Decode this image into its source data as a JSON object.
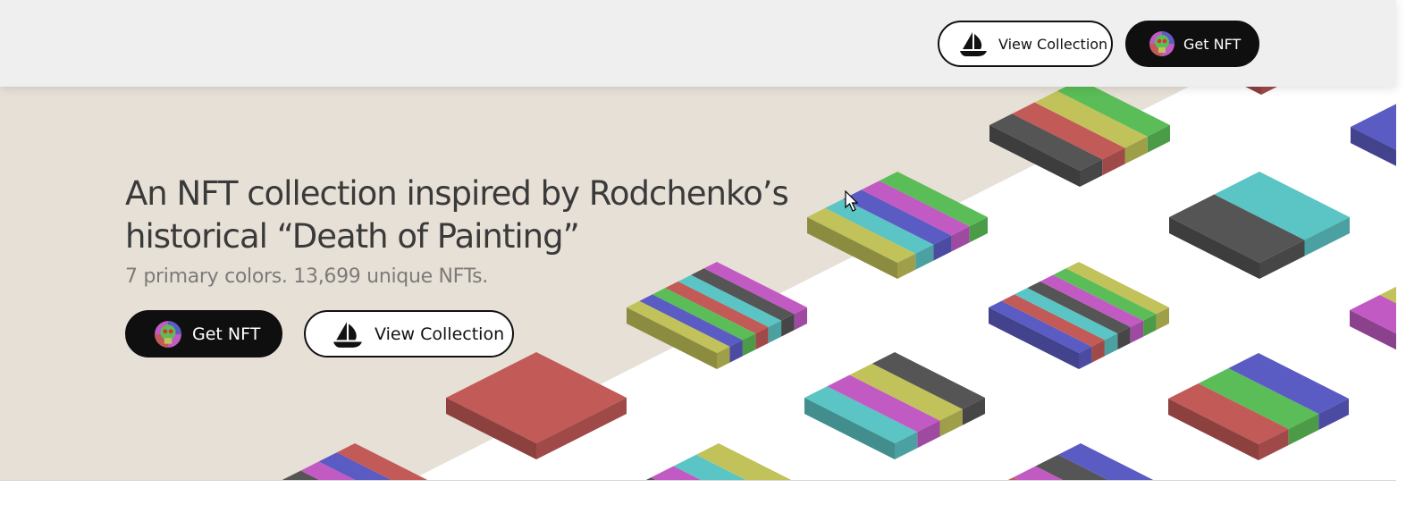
{
  "nav": {
    "view_collection_label": "View Collection",
    "get_nft_label": "Get NFT"
  },
  "hero": {
    "headline": "An NFT collection inspired by Rodchenko’s historical “Death of Painting”",
    "subline": "7 primary colors. 13,699 unique NFTs.",
    "get_nft_label": "Get NFT",
    "view_collection_label": "View Collection"
  },
  "icons": {
    "view_collection": "sailboat-icon",
    "get_nft": "colorful-skull-avatar-icon"
  },
  "colors": {
    "hero_beige": "#e6e0d7",
    "topbar_bg": "#efefef",
    "headline": "#3a3a3a",
    "subline": "#7d7b78",
    "button_dark": "#1a1a1a",
    "tile_red": "#c25a58",
    "tile_green": "#5bbd57",
    "tile_blue": "#5b5bc4",
    "tile_cyan": "#5bc4c4",
    "tile_yellow": "#c2c25a",
    "tile_magenta": "#c25ac4",
    "tile_black": "#555555"
  }
}
